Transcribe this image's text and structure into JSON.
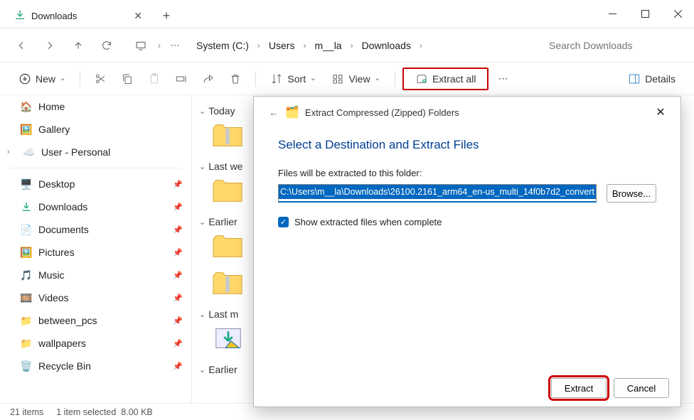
{
  "titlebar": {
    "tab_label": "Downloads"
  },
  "nav": {
    "crumbs": [
      "System (C:)",
      "Users",
      "m__la",
      "Downloads"
    ],
    "search_placeholder": "Search Downloads"
  },
  "toolbar": {
    "new": "New",
    "sort": "Sort",
    "view": "View",
    "extract_all": "Extract all",
    "details": "Details"
  },
  "sidebar": {
    "top": [
      {
        "label": "Home",
        "icon": "home-icon"
      },
      {
        "label": "Gallery",
        "icon": "gallery-icon"
      },
      {
        "label": "User - Personal",
        "icon": "onedrive-icon",
        "expandable": true
      }
    ],
    "pinned": [
      {
        "label": "Desktop",
        "icon": "desktop-icon"
      },
      {
        "label": "Downloads",
        "icon": "downloads-icon"
      },
      {
        "label": "Documents",
        "icon": "documents-icon"
      },
      {
        "label": "Pictures",
        "icon": "pictures-icon"
      },
      {
        "label": "Music",
        "icon": "music-icon"
      },
      {
        "label": "Videos",
        "icon": "videos-icon"
      },
      {
        "label": "between_pcs",
        "icon": "folder-icon"
      },
      {
        "label": "wallpapers",
        "icon": "folder-icon"
      },
      {
        "label": "Recycle Bin",
        "icon": "recycle-icon"
      }
    ]
  },
  "content": {
    "groups": [
      "Today",
      "Last we",
      "Earlier",
      "Last m",
      "Earlier"
    ]
  },
  "status": {
    "items": "21 items",
    "selection": "1 item selected",
    "size": "8.00 KB"
  },
  "dialog": {
    "title": "Extract Compressed (Zipped) Folders",
    "heading": "Select a Destination and Extract Files",
    "label": "Files will be extracted to this folder:",
    "path": "C:\\Users\\m__la\\Downloads\\26100.2161_arm64_en-us_multi_14f0b7d2_convert",
    "browse": "Browse...",
    "checkbox": "Show extracted files when complete",
    "extract": "Extract",
    "cancel": "Cancel"
  }
}
